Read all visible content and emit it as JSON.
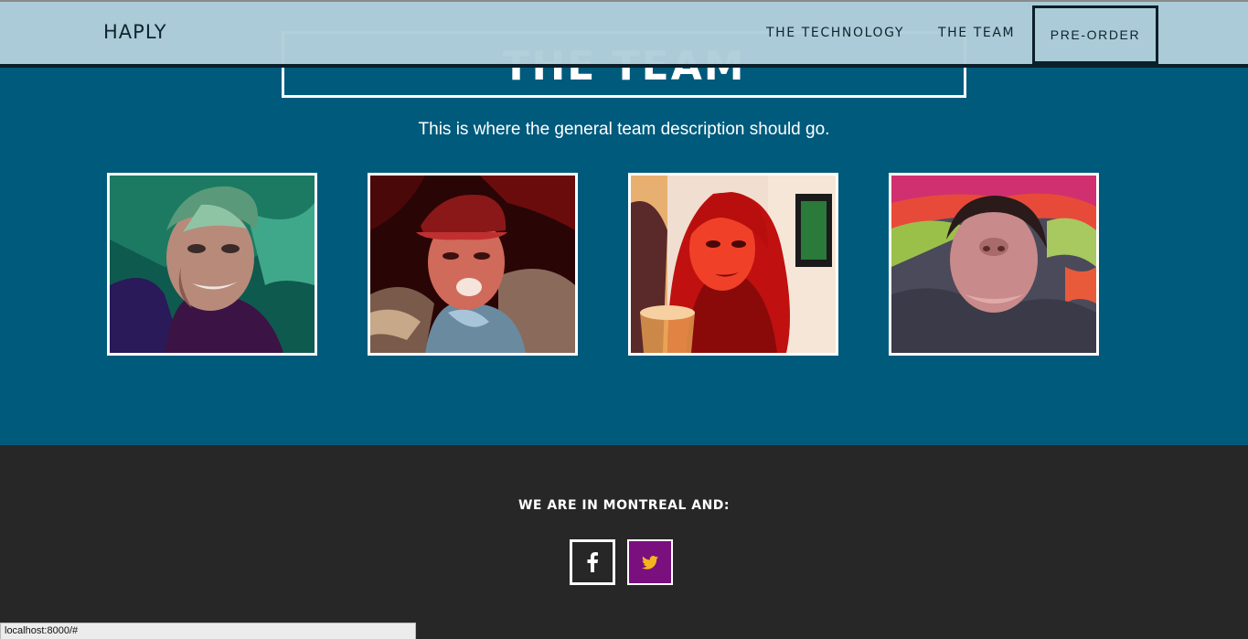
{
  "navbar": {
    "brand": "HAPLY",
    "links": [
      {
        "label": "THE TECHNOLOGY"
      },
      {
        "label": "THE TEAM"
      }
    ],
    "cta_label": "PRE-ORDER"
  },
  "team": {
    "title": "THE TEAM",
    "description": "This is where the general team description should go.",
    "members": [
      {
        "icon": "team-member-photo-1"
      },
      {
        "icon": "team-member-photo-2"
      },
      {
        "icon": "team-member-photo-3"
      },
      {
        "icon": "team-member-photo-4"
      }
    ]
  },
  "footer": {
    "tagline": "WE ARE IN MONTREAL AND:",
    "social": [
      {
        "icon": "facebook-icon"
      },
      {
        "icon": "twitter-icon",
        "color": "#f2b51e",
        "background": "#7a0f7e"
      }
    ]
  },
  "statusbar": {
    "url": "localhost:8000/#"
  },
  "colors": {
    "navbar_bg": "#afceda",
    "team_bg": "#005a7c",
    "footer_bg": "#272727",
    "accent_text": "#ffffff"
  }
}
